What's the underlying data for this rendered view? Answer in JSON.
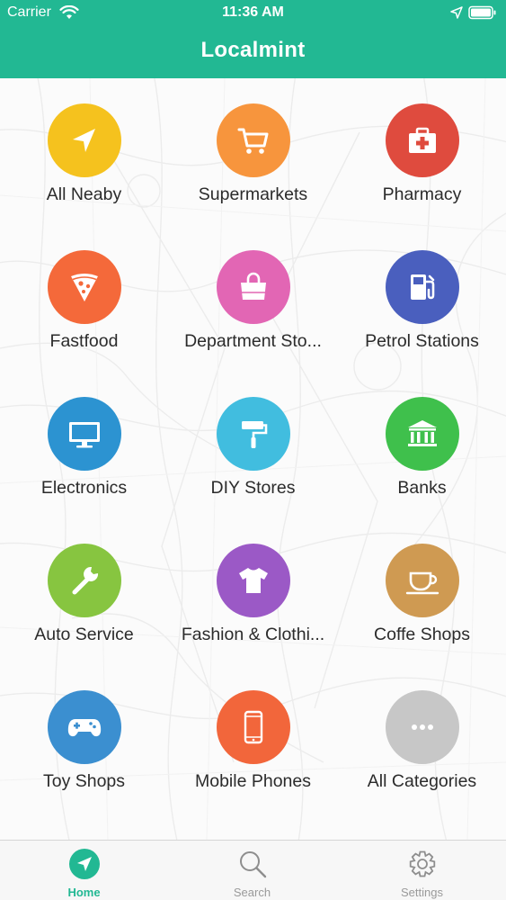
{
  "status_bar": {
    "carrier": "Carrier",
    "time": "11:36 AM"
  },
  "nav": {
    "title": "Localmint"
  },
  "categories": [
    {
      "label": "All Neaby",
      "color": "#f5c21e",
      "icon": "navigation-arrow-icon"
    },
    {
      "label": "Supermarkets",
      "color": "#f7953d",
      "icon": "shopping-cart-icon"
    },
    {
      "label": "Pharmacy",
      "color": "#df4b3e",
      "icon": "first-aid-kit-icon"
    },
    {
      "label": "Fastfood",
      "color": "#f4693a",
      "icon": "pizza-slice-icon"
    },
    {
      "label": "Department Sto...",
      "color": "#e266b4",
      "icon": "shopping-bag-icon"
    },
    {
      "label": "Petrol Stations",
      "color": "#4a5fbe",
      "icon": "fuel-pump-icon"
    },
    {
      "label": "Electronics",
      "color": "#2c93d1",
      "icon": "monitor-icon"
    },
    {
      "label": "DIY Stores",
      "color": "#41bddf",
      "icon": "paint-roller-icon"
    },
    {
      "label": "Banks",
      "color": "#3fc04c",
      "icon": "bank-building-icon"
    },
    {
      "label": "Auto Service",
      "color": "#87c540",
      "icon": "wrench-icon"
    },
    {
      "label": "Fashion & Clothi...",
      "color": "#9b59c6",
      "icon": "t-shirt-icon"
    },
    {
      "label": "Coffe Shops",
      "color": "#cf9a52",
      "icon": "coffee-cup-icon"
    },
    {
      "label": "Toy Shops",
      "color": "#3b8fd0",
      "icon": "gamepad-icon"
    },
    {
      "label": "Mobile Phones",
      "color": "#f2663b",
      "icon": "mobile-phone-icon"
    },
    {
      "label": "All Categories",
      "color": "#c7c7c7",
      "icon": "more-dots-icon"
    }
  ],
  "tabs": [
    {
      "label": "Home",
      "icon": "navigation-arrow-icon",
      "active": true
    },
    {
      "label": "Search",
      "icon": "search-icon",
      "active": false
    },
    {
      "label": "Settings",
      "icon": "gear-icon",
      "active": false
    }
  ],
  "colors": {
    "brand": "#22b893",
    "tab_inactive": "#9a9a9a"
  }
}
